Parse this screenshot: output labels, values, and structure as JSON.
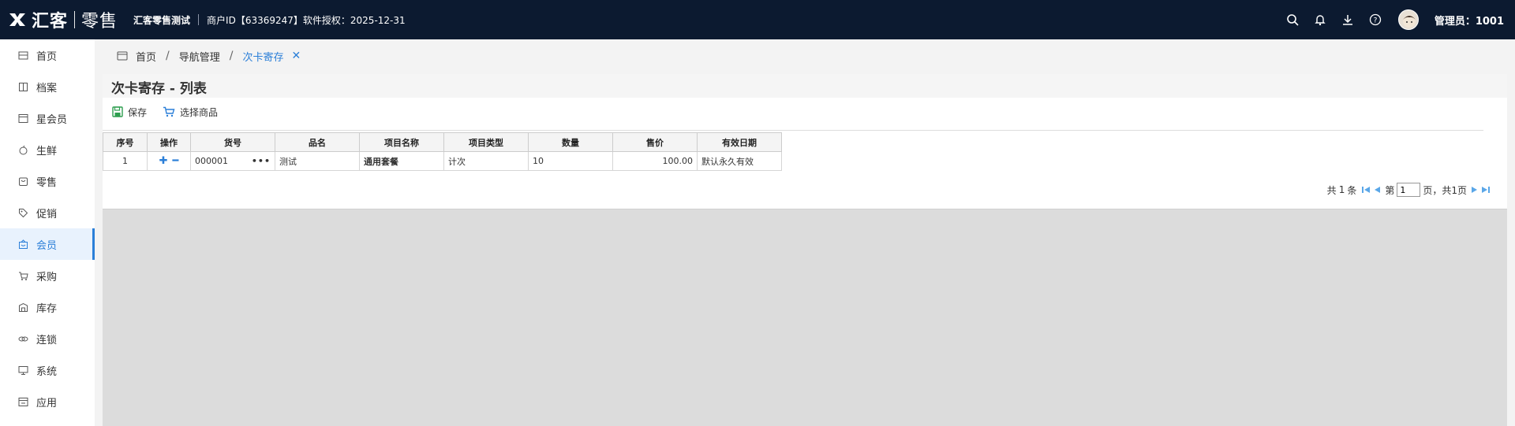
{
  "header": {
    "logo_text": "汇客",
    "logo_sub": "零售",
    "store_name": "汇客零售测试",
    "merchant_info": "商户ID【63369247】软件授权：2025-12-31",
    "admin_label": "管理员：1001"
  },
  "sidebar": {
    "items": [
      {
        "label": "首页",
        "icon": "home-icon"
      },
      {
        "label": "档案",
        "icon": "archive-icon"
      },
      {
        "label": "星会员",
        "icon": "star-member-icon"
      },
      {
        "label": "生鲜",
        "icon": "apple-icon"
      },
      {
        "label": "零售",
        "icon": "retail-icon"
      },
      {
        "label": "促销",
        "icon": "tag-icon"
      },
      {
        "label": "会员",
        "icon": "member-icon"
      },
      {
        "label": "采购",
        "icon": "cart-icon"
      },
      {
        "label": "库存",
        "icon": "warehouse-icon"
      },
      {
        "label": "连锁",
        "icon": "chain-icon"
      },
      {
        "label": "系统",
        "icon": "monitor-icon"
      },
      {
        "label": "应用",
        "icon": "apps-icon"
      }
    ],
    "active_index": 6
  },
  "breadcrumb": {
    "home": "首页",
    "parent": "导航管理",
    "current": "次卡寄存"
  },
  "page": {
    "title": "次卡寄存 - 列表",
    "save_label": "保存",
    "select_goods_label": "选择商品"
  },
  "table": {
    "headers": [
      "序号",
      "操作",
      "货号",
      "品名",
      "项目名称",
      "项目类型",
      "数量",
      "售价",
      "有效日期"
    ],
    "rows": [
      {
        "index": "1",
        "code": "000001",
        "name": "测试",
        "project_name": "通用套餐",
        "project_type": "计次",
        "quantity": "10",
        "price": "100.00",
        "valid": "默认永久有效"
      }
    ]
  },
  "pager": {
    "total_prefix": "共",
    "total": "1",
    "total_suffix": "条",
    "page_prefix": "第",
    "page_value": "1",
    "page_suffix": "页，共1页"
  },
  "colors": {
    "topbar": "#0c1a30",
    "accent": "#2b7fd8",
    "save_green": "#2e9e4f"
  }
}
